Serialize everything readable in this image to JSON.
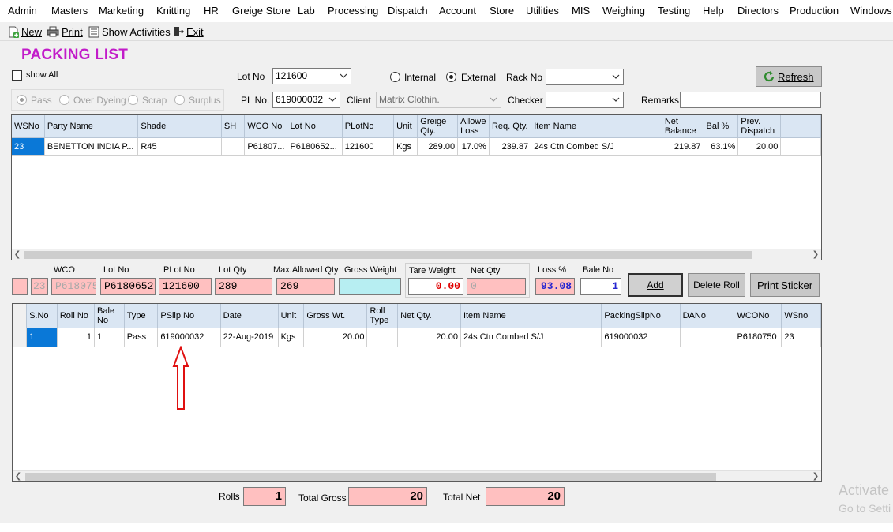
{
  "menu": [
    {
      "label": "Admin"
    },
    {
      "label": "Masters"
    },
    {
      "label": "Marketing"
    },
    {
      "label": "Knitting"
    },
    {
      "label": "HR"
    },
    {
      "label": "Greige Store"
    },
    {
      "label": "Lab"
    },
    {
      "label": "Processing"
    },
    {
      "label": "Dispatch"
    },
    {
      "label": "Account"
    },
    {
      "label": "Store"
    },
    {
      "label": "Utilities"
    },
    {
      "label": "MIS"
    },
    {
      "label": "Weighing"
    },
    {
      "label": "Testing"
    },
    {
      "label": "Help"
    },
    {
      "label": "Directors"
    },
    {
      "label": "Production"
    },
    {
      "label": "Windows"
    }
  ],
  "toolbar": {
    "new_label": "New",
    "print_label": "Print",
    "show_activities_label": "Show Activities",
    "exit_label": "Exit"
  },
  "form": {
    "title": "PACKING LIST",
    "show_all_label": "show All",
    "lot_no_label": "Lot No",
    "lot_no_value": "121600",
    "internal_label": "Internal",
    "external_label": "External",
    "rack_no_label": "Rack No",
    "rack_no_value": "",
    "refresh_label": "Refresh",
    "pass_label": "Pass",
    "over_dyeing_label": "Over Dyeing",
    "scrap_label": "Scrap",
    "surplus_label": "Surplus",
    "pl_no_label": "PL No.",
    "pl_no_value": "619000032",
    "client_label": "Client",
    "client_value": "Matrix Clothin.",
    "checker_label": "Checker",
    "checker_value": "",
    "remarks_label": "Remarks",
    "remarks_value": ""
  },
  "top_grid": {
    "headers": [
      "WSNo",
      "Party Name",
      "Shade",
      "SH",
      "WCO No",
      "Lot No",
      "PLotNo",
      "Unit",
      "Greige Qty.",
      "Allowe Loss",
      "Req. Qty.",
      "Item Name",
      "Net Balance",
      "Bal %",
      "Prev. Dispatch"
    ],
    "rows": [
      [
        "23",
        "BENETTON INDIA P...",
        "R45",
        "",
        "P61807...",
        "P6180652...",
        "121600",
        "Kgs",
        "289.00",
        "17.0%",
        "239.87",
        "24s Ctn Combed S/J",
        "219.87",
        "63.1%",
        "20.00"
      ]
    ]
  },
  "entry": {
    "labels": {
      "wco": "WCO",
      "lot_no": "Lot No",
      "plot_no": "PLot No",
      "lot_qty": "Lot Qty",
      "max_allowed_qty": "Max.Allowed Qty",
      "gross_weight": "Gross Weight",
      "tare_weight": "Tare Weight",
      "net_qty": "Net Qty",
      "loss_pct": "Loss %",
      "bale_no": "Bale No"
    },
    "values": {
      "blank": "",
      "ws_no": "23",
      "wco": "P618075",
      "lot_no": "P6180652",
      "plot_no": "121600",
      "lot_qty": "289",
      "max_allowed_qty": "269",
      "gross_weight": "",
      "tare_weight": "0.00",
      "net_qty": "0",
      "loss_pct": "93.08",
      "bale_no": "1"
    },
    "add_label": "Add",
    "delete_roll_label": "Delete Roll",
    "print_sticker_label": "Print Sticker"
  },
  "bottom_grid": {
    "headers": [
      "S.No",
      "Roll No",
      "Bale No",
      "Type",
      "PSlip No",
      "Date",
      "Unit",
      "Gross Wt.",
      "Roll Type",
      "Net Qty.",
      "Item Name",
      "PackingSlipNo",
      "DANo",
      "WCONo",
      "WSno"
    ],
    "rows": [
      [
        "1",
        "1",
        "1",
        "Pass",
        "619000032",
        "22-Aug-2019",
        "Kgs",
        "20.00",
        "",
        "20.00",
        "24s Ctn Combed S/J",
        "619000032",
        "",
        "P6180750",
        "23"
      ]
    ]
  },
  "summary": {
    "rolls_label": "Rolls",
    "rolls_value": "1",
    "total_gross_label": "Total Gross",
    "total_gross_value": "20",
    "total_net_label": "Total Net",
    "total_net_value": "20"
  },
  "watermark": {
    "line1": "Activate",
    "line2": "Go to Setti"
  },
  "colors": {
    "title": "#c21bc9",
    "grid_header": "#dae6f3",
    "selection": "#0a78d7",
    "pink_field": "#ffc0c0",
    "cyan_field": "#b7eef2",
    "annotation_arrow": "#e01010"
  }
}
